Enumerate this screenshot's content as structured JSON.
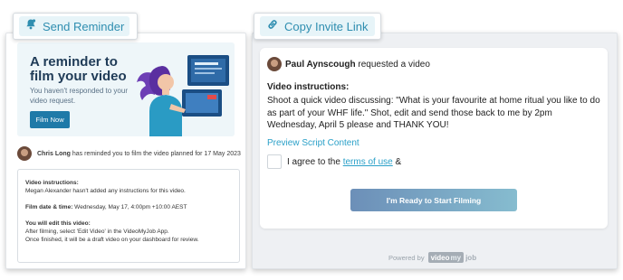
{
  "colors": {
    "accent": "#2aa0c8",
    "tab_blue": "#2f8eb0",
    "hero_bg": "#eef6f9",
    "button_dark": "#1f7aa8"
  },
  "left_tab": {
    "label": "Send Reminder",
    "icon": "bell-with-person-icon"
  },
  "right_tab": {
    "label": "Copy Invite Link",
    "icon": "link-icon"
  },
  "reminder_email": {
    "hero": {
      "title": "A reminder to film your video",
      "subtitle": "You haven't responded to your video request.",
      "button_label": "Film Now"
    },
    "reminder_line": {
      "sender": "Chris Long",
      "text": " has reminded you to film the video planned for 17 May 2023"
    },
    "instructions": {
      "heading": "Video instructions:",
      "body": "Megan Alexander hasn't added any instructions for this video.",
      "date_label": "Film date & time:",
      "date_value": " Wednesday, May 17, 4:00pm +10:00 AEST",
      "edit_heading": "You will edit this video:",
      "edit_line_1": "After filming, select 'Edit Video' in the VideoMyJob App.",
      "edit_line_2": "Once finished, it will be a draft video on your dashboard for review."
    }
  },
  "invite_page": {
    "requester": "Paul Aynscough",
    "requested_text": " requested a video",
    "instructions_heading": "Video instructions:",
    "instructions_body": "Shoot a quick video discussing: \"What is your favourite at home ritual you like to do as part of your WHF life.\" Shot, edit and send those back to me by 2pm Wednesday, April 5 please and THANK YOU!",
    "preview_link": "Preview Script Content",
    "agree_prefix": "I agree to the ",
    "terms_link": "terms of use",
    "agree_suffix": " &",
    "start_button": "I'm Ready to Start Filming",
    "powered_by": "Powered by",
    "logo_video": "video",
    "logo_my": "my",
    "logo_job": "job"
  }
}
